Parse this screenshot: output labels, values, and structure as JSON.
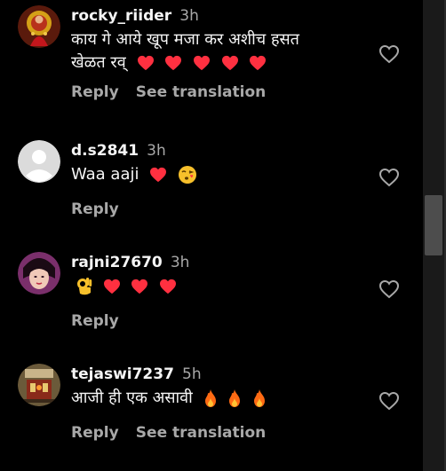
{
  "comments": [
    {
      "username": "rocky_riider",
      "time": "3h",
      "text_line1": "काय गे आये खूप मजा कर अशीच हसत",
      "text_line2": "खेळत रव्",
      "emojis": [
        "red-heart",
        "red-heart",
        "red-heart",
        "red-heart",
        "red-heart"
      ],
      "actions": [
        "Reply",
        "See translation"
      ]
    },
    {
      "username": "d.s2841",
      "time": "3h",
      "text": "Waa aaji",
      "emojis": [
        "red-heart",
        "face-blowing-kiss"
      ],
      "actions": [
        "Reply"
      ]
    },
    {
      "username": "rajni27670",
      "time": "3h",
      "text": "",
      "emojis": [
        "ok-hand",
        "red-heart",
        "red-heart",
        "red-heart"
      ],
      "actions": [
        "Reply"
      ]
    },
    {
      "username": "tejaswi7237",
      "time": "5h",
      "text": "आजी ही एक असावी",
      "emojis": [
        "fire",
        "fire",
        "fire"
      ],
      "actions": [
        "Reply",
        "See translation"
      ]
    }
  ],
  "colors": {
    "background": "#000000",
    "text_primary": "#f5f5f5",
    "text_secondary": "#a8a8a8",
    "heart_red": "#ff3040",
    "scrollbar_track": "#1a1a1a",
    "scrollbar_thumb": "#4d4d4d"
  }
}
